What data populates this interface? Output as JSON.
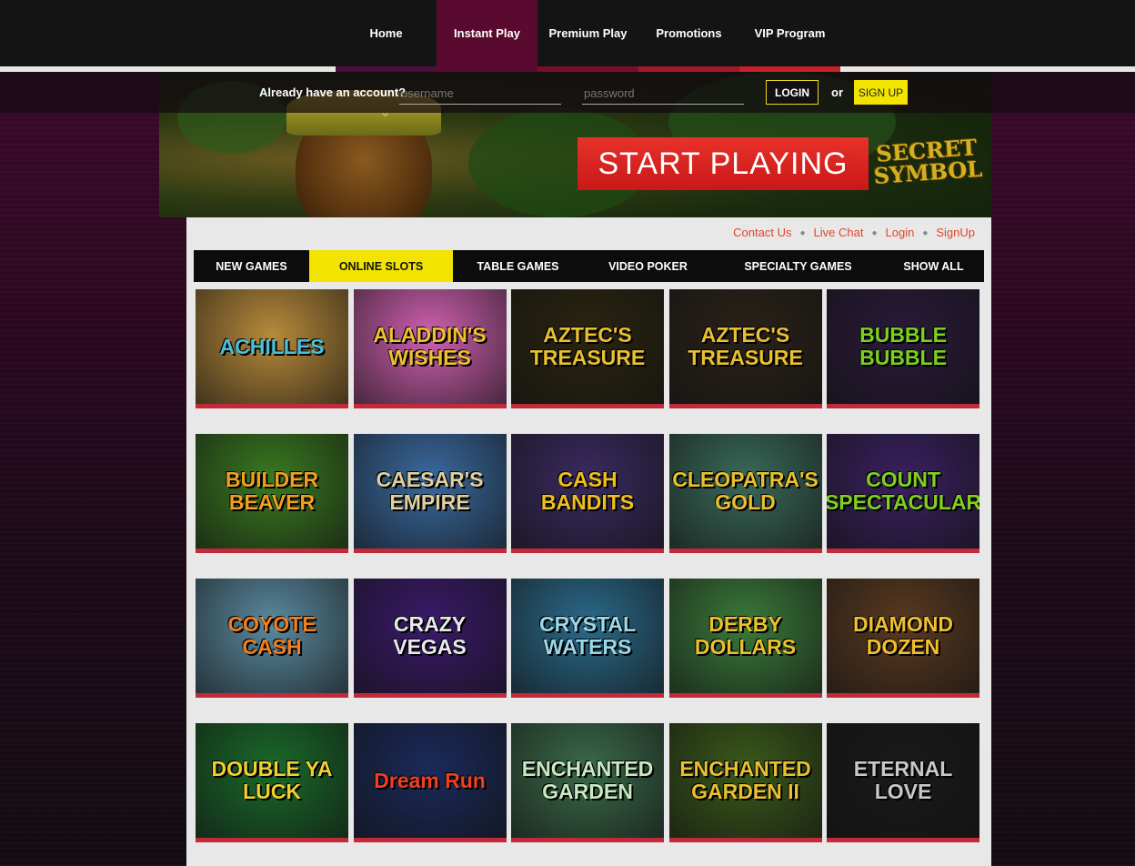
{
  "nav": {
    "items": [
      {
        "label": "Home",
        "active": false
      },
      {
        "label": "Instant Play",
        "active": true
      },
      {
        "label": "Premium Play",
        "active": false
      },
      {
        "label": "Promotions",
        "active": false
      },
      {
        "label": "VIP Program",
        "active": false
      }
    ],
    "bar_colors": [
      "#4a0f3a",
      "#5a0a2e",
      "#7a0e2a",
      "#a01a2a",
      "#c8202a"
    ]
  },
  "login": {
    "prompt": "Already have an account?",
    "username_placeholder": "username",
    "password_placeholder": "password",
    "login_label": "LOGIN",
    "or_label": "or",
    "signup_label": "SIGN UP"
  },
  "banner": {
    "cta": "START PLAYING",
    "promo_game": "SECRET SYMBOL",
    "chevron_icon": "chevron-down-icon"
  },
  "links": [
    {
      "label": "Contact Us"
    },
    {
      "label": "Live Chat"
    },
    {
      "label": "Login"
    },
    {
      "label": "SignUp"
    }
  ],
  "categories": [
    {
      "label": "NEW GAMES",
      "active": false
    },
    {
      "label": "ONLINE SLOTS",
      "active": true
    },
    {
      "label": "TABLE GAMES",
      "active": false
    },
    {
      "label": "VIDEO POKER",
      "active": false
    },
    {
      "label": "SPECIALTY GAMES",
      "active": false
    },
    {
      "label": "SHOW ALL",
      "active": false
    }
  ],
  "games": [
    {
      "title": "ACHILLES",
      "bg": "#b88a3a",
      "fg": "#4ac0d8"
    },
    {
      "title": "ALADDIN'S WISHES",
      "bg": "#d060b0",
      "fg": "#f0c030"
    },
    {
      "title": "AZTEC'S TREASURE",
      "bg": "#2a2410",
      "fg": "#e8c030"
    },
    {
      "title": "AZTEC'S TREASURE",
      "bg": "#2a2218",
      "fg": "#e8c030"
    },
    {
      "title": "BUBBLE BUBBLE",
      "bg": "#2a1a3a",
      "fg": "#7ad020"
    },
    {
      "title": "BUILDER BEAVER",
      "bg": "#3a7a20",
      "fg": "#f0a020"
    },
    {
      "title": "CAESAR'S EMPIRE",
      "bg": "#3a6aa0",
      "fg": "#e0d0a0"
    },
    {
      "title": "CASH BANDITS",
      "bg": "#3a2a60",
      "fg": "#f0c020"
    },
    {
      "title": "CLEOPATRA'S GOLD",
      "bg": "#3a6a5a",
      "fg": "#e8c030"
    },
    {
      "title": "COUNT SPECTACULAR",
      "bg": "#3a2060",
      "fg": "#80d020"
    },
    {
      "title": "COYOTE CASH",
      "bg": "#5a8aa0",
      "fg": "#f08020"
    },
    {
      "title": "CRAZY VEGAS",
      "bg": "#3a1a6a",
      "fg": "#e8e8f0"
    },
    {
      "title": "CRYSTAL WATERS",
      "bg": "#2a6a8a",
      "fg": "#9ad8e8"
    },
    {
      "title": "DERBY DOLLARS",
      "bg": "#3a7a3a",
      "fg": "#e8c030"
    },
    {
      "title": "DIAMOND DOZEN",
      "bg": "#5a3a20",
      "fg": "#f0c030"
    },
    {
      "title": "DOUBLE YA LUCK",
      "bg": "#1a6a2a",
      "fg": "#f0d030"
    },
    {
      "title": "Dream Run",
      "bg": "#1a2a5a",
      "fg": "#f04020"
    },
    {
      "title": "ENCHANTED GARDEN",
      "bg": "#3a6a4a",
      "fg": "#c8e8c0"
    },
    {
      "title": "ENCHANTED GARDEN II",
      "bg": "#3a5a1a",
      "fg": "#e8c030"
    },
    {
      "title": "ETERNAL LOVE",
      "bg": "#1a1a1a",
      "fg": "#c8c8c8"
    }
  ]
}
